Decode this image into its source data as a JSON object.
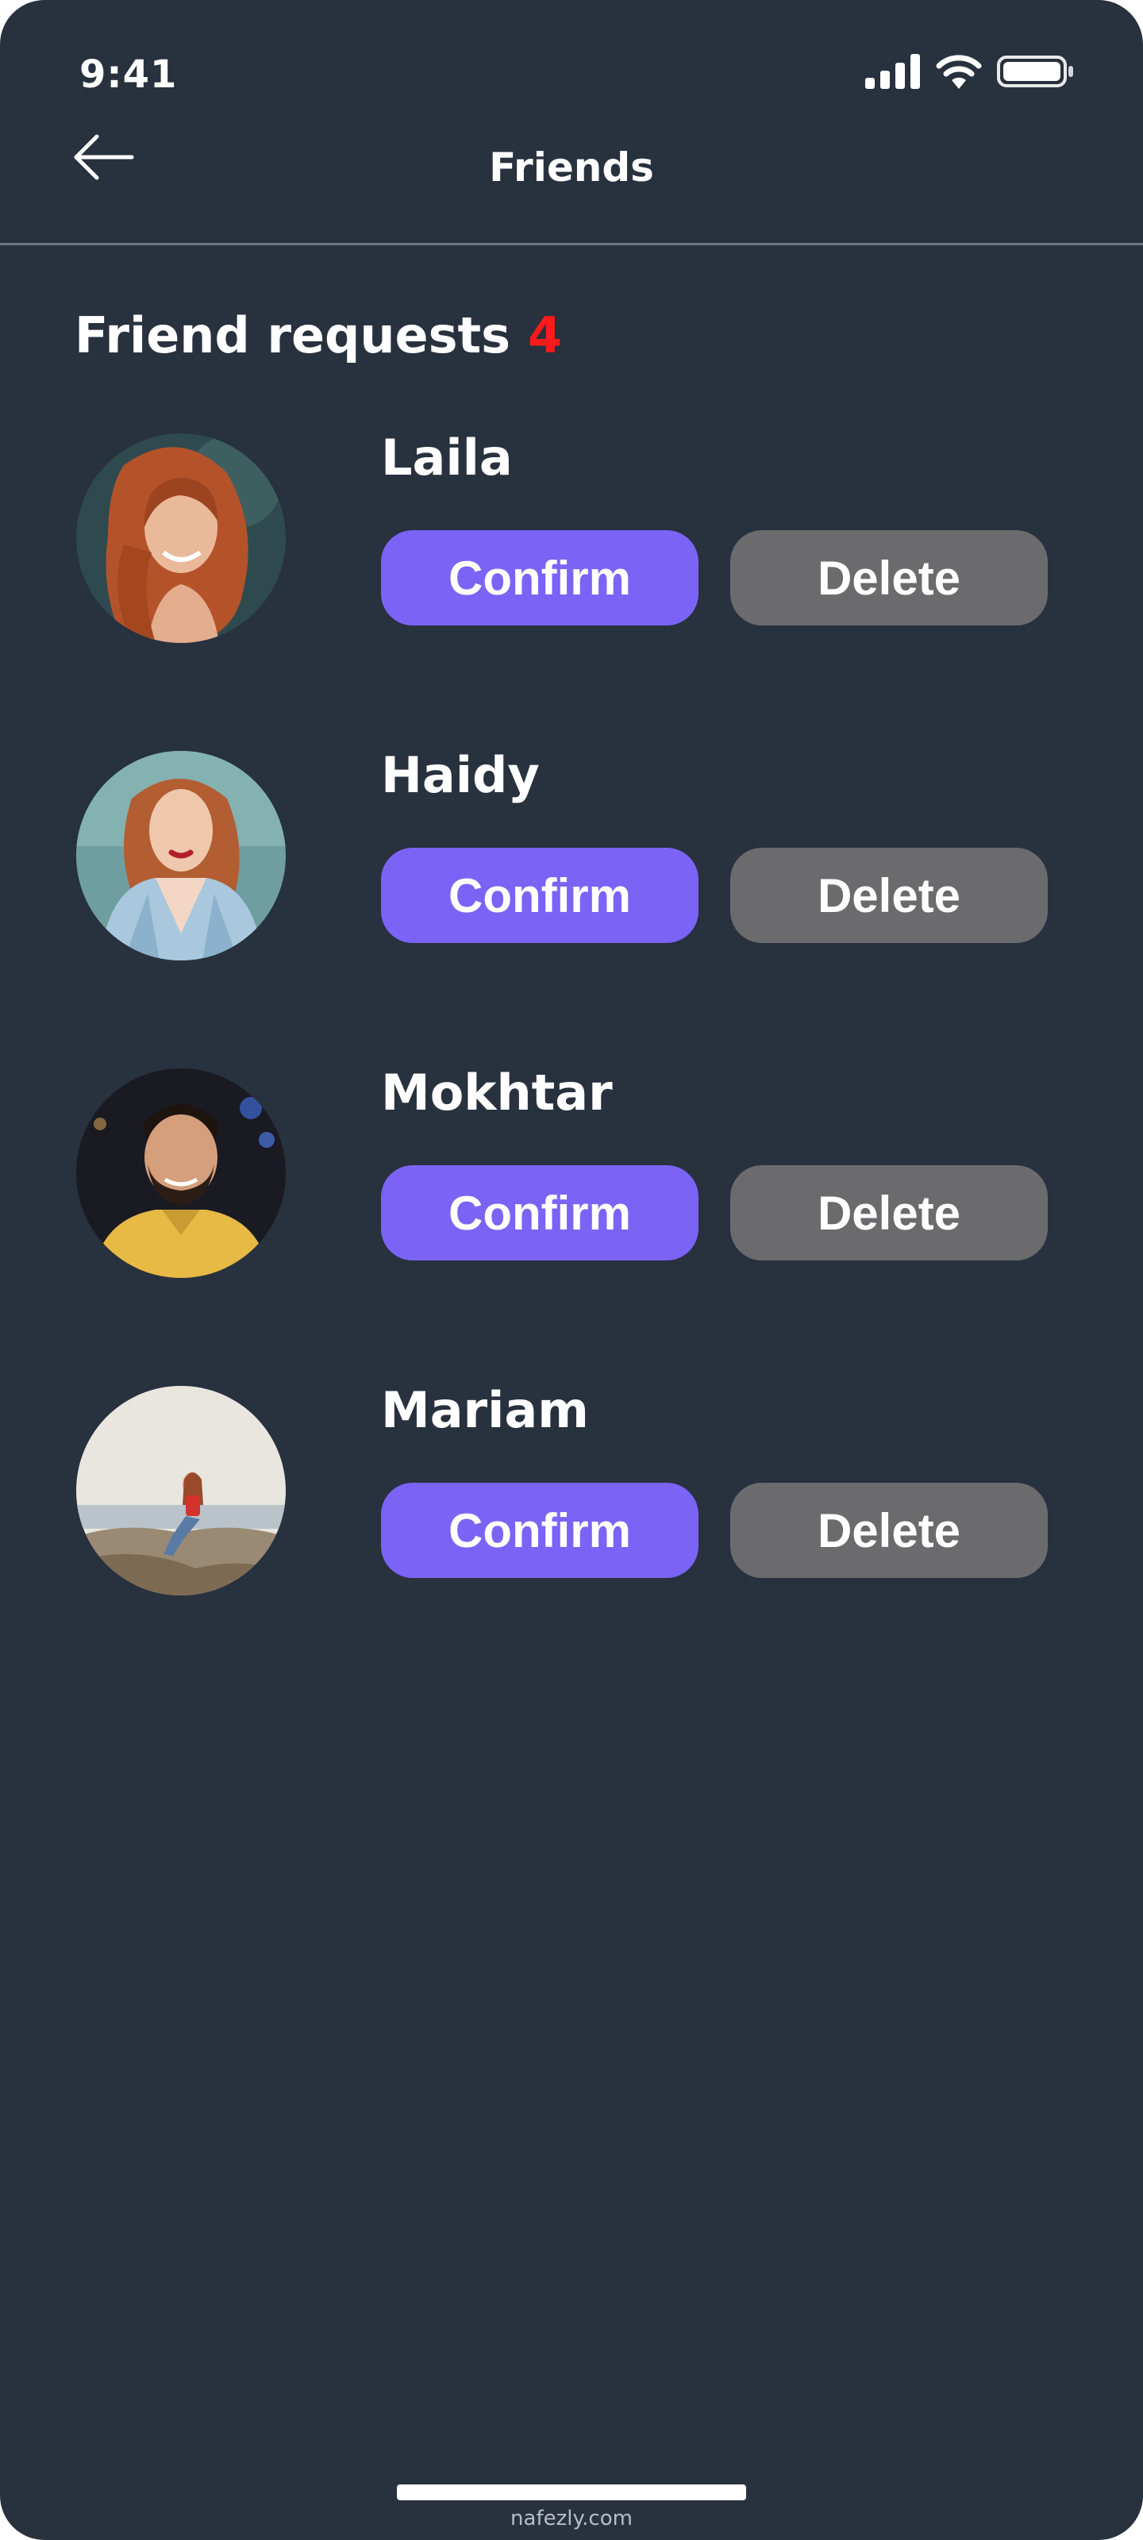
{
  "status_bar": {
    "time": "9:41",
    "icons": [
      "signal-icon",
      "wifi-icon",
      "battery-icon"
    ]
  },
  "header": {
    "back_icon": "arrow-left-icon",
    "title": "Friends"
  },
  "section": {
    "title": "Friend requests",
    "count": "4"
  },
  "requests": [
    {
      "name": "Laila",
      "confirm_label": "Confirm",
      "delete_label": "Delete"
    },
    {
      "name": "Haidy",
      "confirm_label": "Confirm",
      "delete_label": "Delete"
    },
    {
      "name": "Mokhtar",
      "confirm_label": "Confirm",
      "delete_label": "Delete"
    },
    {
      "name": "Mariam",
      "confirm_label": "Confirm",
      "delete_label": "Delete"
    }
  ],
  "watermark": "nafezly.com",
  "colors": {
    "background": "#28313e",
    "confirm": "#7b63f6",
    "delete": "#6b6b6d",
    "count": "#ff1a1a",
    "text": "#ffffff"
  }
}
